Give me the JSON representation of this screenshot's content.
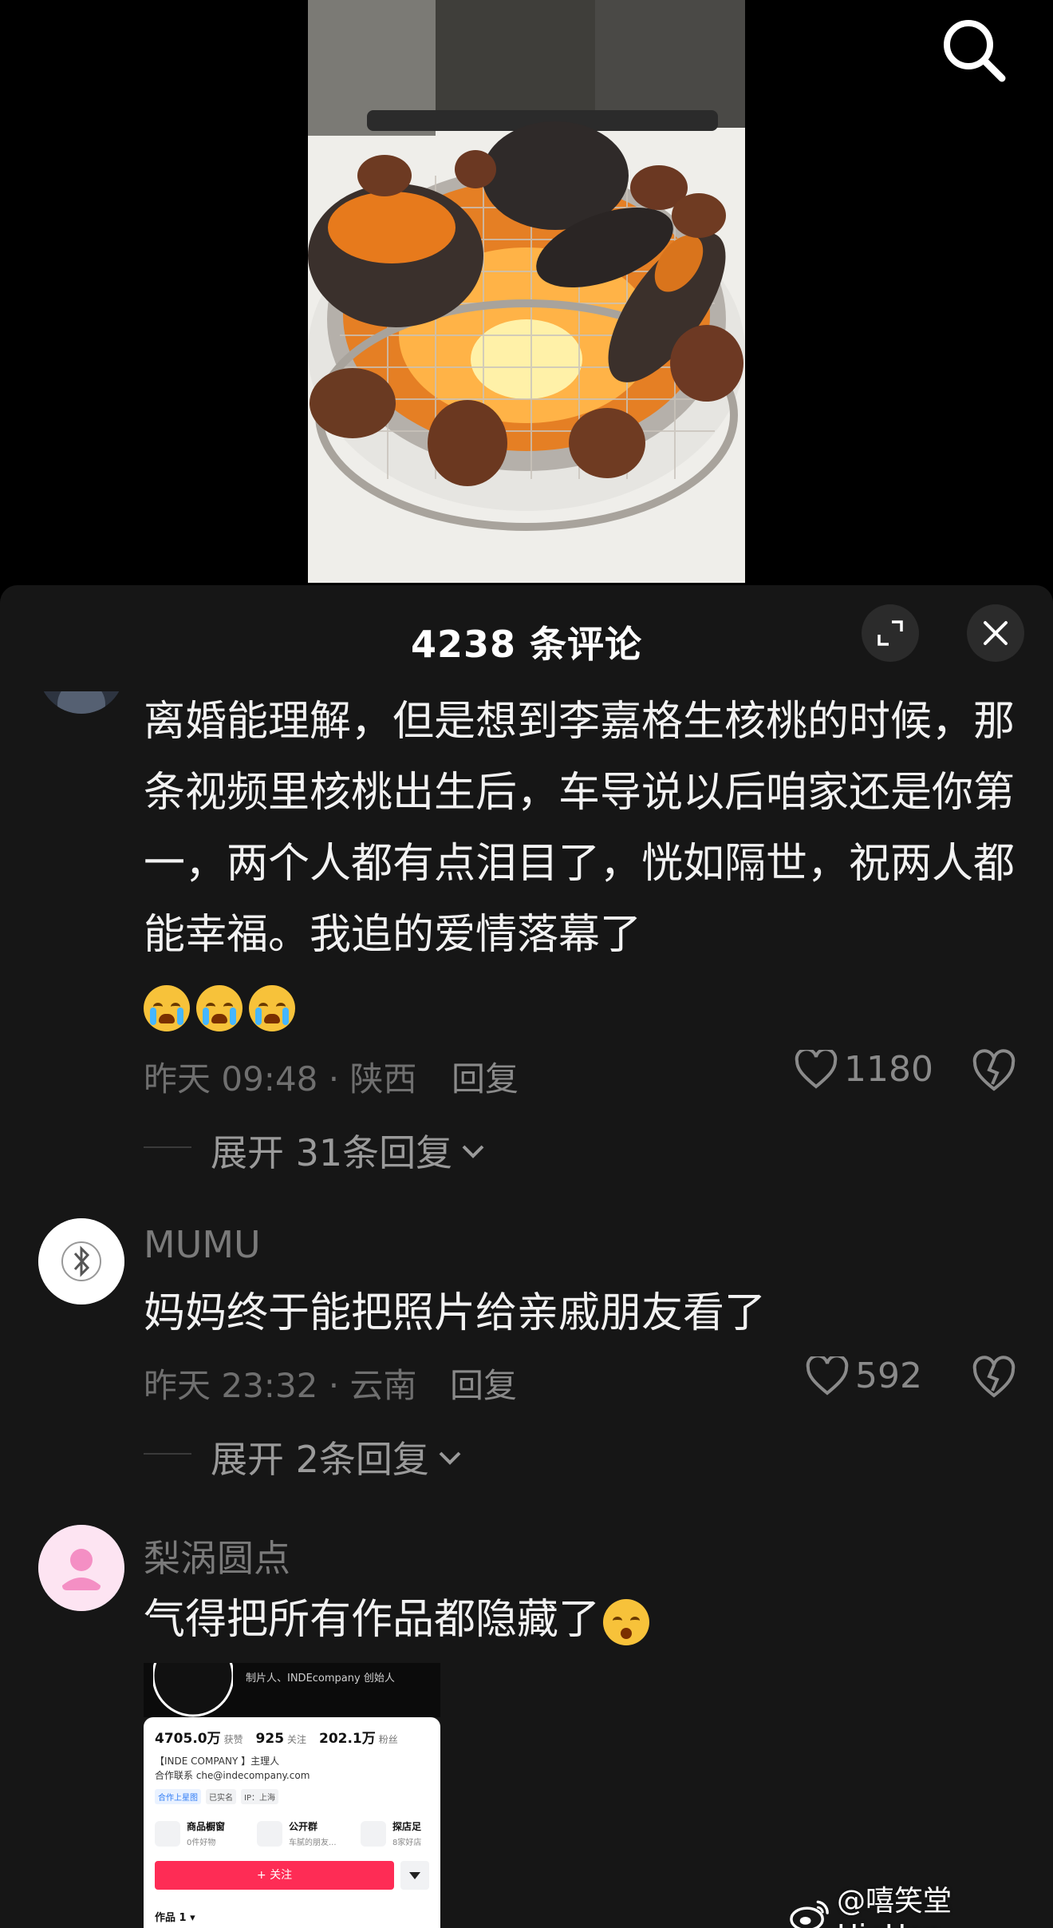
{
  "header": {
    "comment_count_title": "4238 条评论"
  },
  "comments": [
    {
      "text": "离婚能理解，但是想到李嘉格生核桃的时候，那条视频里核桃出生后，车导说以后咱家还是你第一，两个人都有点泪目了，恍如隔世，祝两人都能幸福。我追的爱情落幕了",
      "emojis": [
        "crying-face",
        "crying-face",
        "crying-face"
      ],
      "time_location": "昨天 09:48 · 陕西",
      "reply_label": "回复",
      "likes": "1180",
      "expand_replies": "展开 31条回复"
    },
    {
      "username": "MUMU",
      "text": "妈妈终于能把照片给亲戚朋友看了",
      "time_location": "昨天 23:32 · 云南",
      "reply_label": "回复",
      "likes": "592",
      "expand_replies": "展开 2条回复"
    },
    {
      "username": "梨涡圆点",
      "text": "气得把所有作品都隐藏了",
      "emoji": "thinking-face"
    }
  ],
  "attached_image": {
    "role_line": "制片人、INDEcompany 创始人",
    "stats": [
      {
        "value": "4705.0万",
        "label": "获赞"
      },
      {
        "value": "925",
        "label": "关注"
      },
      {
        "value": "202.1万",
        "label": "粉丝"
      }
    ],
    "bio_line1": "【INDE COMPANY 】主理人",
    "bio_line2": "合作联系 che@indecompany.com",
    "tags": [
      "合作上星图",
      "已实名",
      "IP：上海"
    ],
    "shops": [
      {
        "title": "商品橱窗",
        "sub": "0件好物"
      },
      {
        "title": "公开群",
        "sub": "车腻的朋友..."
      },
      {
        "title": "探店足",
        "sub": "8家好店"
      }
    ],
    "follow_button": "+ 关注",
    "works_label": "作品 1 ▾"
  },
  "watermark": {
    "text": "@嘻笑堂HipHop"
  },
  "colors": {
    "sheet_bg": "#161616",
    "text_primary": "#f2f2f2",
    "text_muted": "#6f6f6f",
    "accent_red": "#fe2c55"
  }
}
